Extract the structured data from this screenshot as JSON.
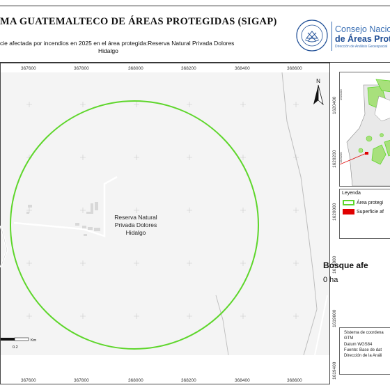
{
  "header": {
    "title": "MA GUATEMALTECO DE ÁREAS PROTEGIDAS  (SIGAP)",
    "subtitle_line1": "cie afectada por incendios en 2025 en el área protegida:Reserva Natural Privada Dolores",
    "subtitle_line2": "Hidalgo"
  },
  "logo": {
    "line1": "Consejo Nacional",
    "line2": "de Áreas Protegi",
    "line3": "Dirección de Análisis Geoespacial",
    "seal_text_top": "GOBIERNO DE LA REPÚBLICA",
    "seal_text_bottom": "GUATEMALA"
  },
  "map": {
    "x_ticks": [
      "367600",
      "367800",
      "368000",
      "368200",
      "368400",
      "368600"
    ],
    "y_ticks": [
      "1620400",
      "1620200",
      "1620000",
      "1619800",
      "1619600",
      "1619400"
    ],
    "area_label_line1": "Reserva Natural",
    "area_label_line2": "Privada Dolores",
    "area_label_line3": "Hidalgo",
    "north_label": "N",
    "scale_unit": "Km",
    "scale_value": "0.2",
    "colors": {
      "protected_area": "#5ed62b",
      "affected": "#e00000",
      "roads": "#bdbdbd"
    }
  },
  "legend": {
    "title": "Leyenda",
    "items": [
      {
        "label": "Área protegi",
        "color": "#5ed62b",
        "type": "outline"
      },
      {
        "label": "Superficie af",
        "color": "#e00000",
        "type": "fill"
      }
    ]
  },
  "forest": {
    "title": "Bosque afe",
    "value": "0 ha"
  },
  "system": {
    "lines": [
      "Sistema de coordena",
      "GTM",
      "Datum WGS84",
      "Fuente: Base de dat",
      "Dirección de la Análi"
    ]
  }
}
